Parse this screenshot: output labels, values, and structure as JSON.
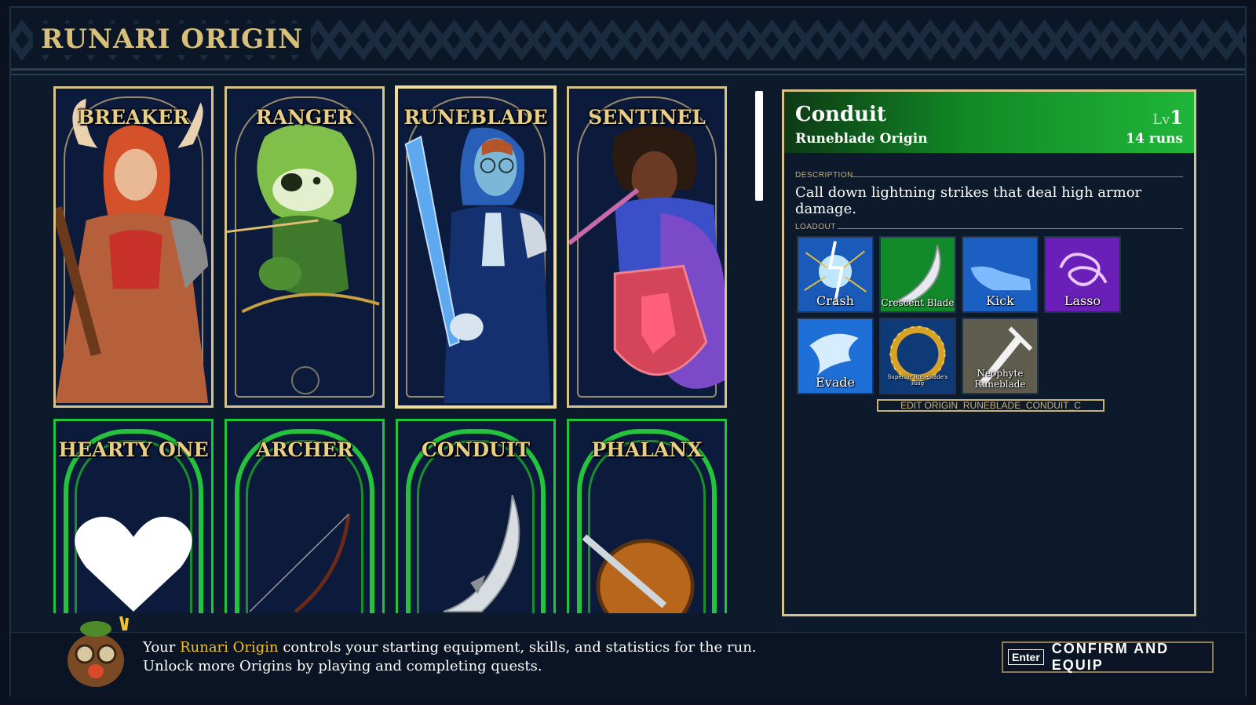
{
  "header": {
    "title": "RUNARI ORIGIN"
  },
  "origins_top": [
    {
      "name": "BREAKER",
      "icon": "breaker-portrait"
    },
    {
      "name": "RANGER",
      "icon": "ranger-portrait"
    },
    {
      "name": "RUNEBLADE",
      "icon": "runeblade-portrait",
      "selected": true
    },
    {
      "name": "SENTINEL",
      "icon": "sentinel-portrait"
    }
  ],
  "origins_bottom": [
    {
      "name": "HEARTY ONE",
      "icon": "heart-icon"
    },
    {
      "name": "ARCHER",
      "icon": "bow-icon"
    },
    {
      "name": "CONDUIT",
      "icon": "crescent-blade-icon",
      "selected": true
    },
    {
      "name": "PHALANX",
      "icon": "shield-sword-icon"
    }
  ],
  "detail": {
    "title": "Conduit",
    "subtitle": "Runeblade Origin",
    "level_prefix": "Lv",
    "level": "1",
    "runs": "14 runs",
    "description_label": "DESCRIPTION",
    "description": "Call down lightning strikes that deal high armor damage.",
    "loadout_label": "LOADOUT",
    "loadout": [
      {
        "label": "Crash",
        "icon": "crash-lightning-icon"
      },
      {
        "label": "Crescent Blade",
        "icon": "crescent-blade-icon"
      },
      {
        "label": "Kick",
        "icon": "kick-boot-icon"
      },
      {
        "label": "Lasso",
        "icon": "lasso-icon"
      },
      {
        "label": "Evade",
        "icon": "evade-dragon-icon"
      },
      {
        "label": "Superior Runeblade's Ring",
        "icon": "ring-icon"
      },
      {
        "label": "Neophyte Runeblade",
        "icon": "sword-icon"
      }
    ],
    "edit_link": "EDIT ORIGIN_RUNEBLADE_CONDUIT_C"
  },
  "footer": {
    "line1_pre": "Your ",
    "line1_highlight": "Runari Origin",
    "line1_post": " controls your starting equipment, skills, and statistics for the run.",
    "line2": "Unlock more Origins by playing and completing quests.",
    "confirm_key": "Enter",
    "confirm_label": "CONFIRM AND EQUIP"
  },
  "colors": {
    "gold": "#d9c07a",
    "green_frame": "#1ec43a",
    "highlight": "#f1c12e",
    "panel_bg": "#0c1a2c"
  }
}
